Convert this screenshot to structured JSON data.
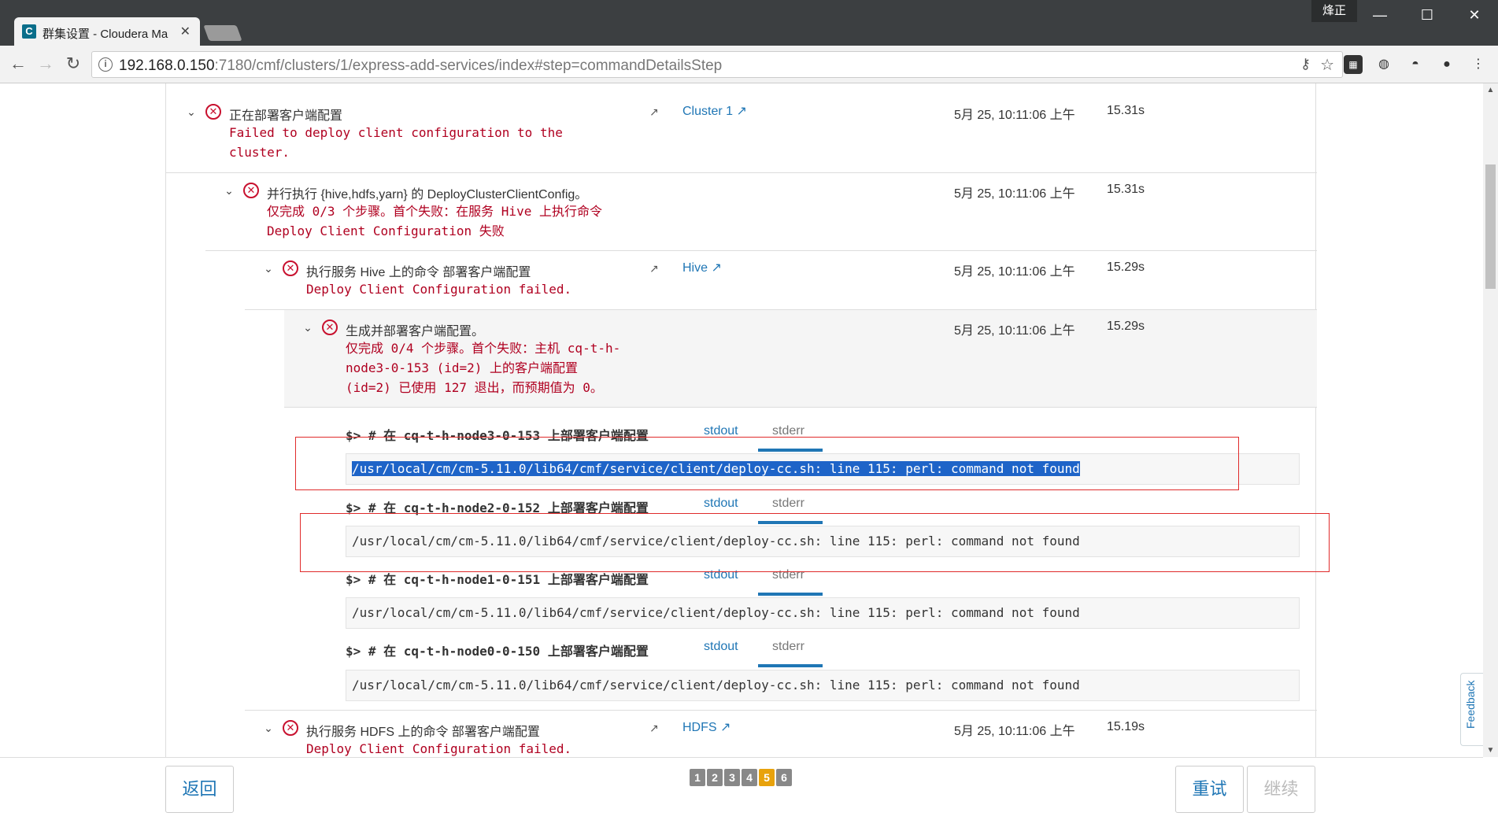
{
  "browser": {
    "tab_title": "群集设置 - Cloudera Ma",
    "tab_favicon": "C",
    "user_name": "烽正",
    "url_host": "192.168.0.150",
    "url_rest": ":7180/cmf/clusters/1/express-add-services/index#step=commandDetailsStep"
  },
  "commands": [
    {
      "title": "正在部署客户端配置",
      "message": "Failed to deploy client configuration to the\ncluster.",
      "target": "Cluster 1",
      "time": "5月 25, 10:11:06 上午",
      "duration": "15.31s"
    },
    {
      "title": "并行执行 {hive,hdfs,yarn} 的 DeployClusterClientConfig。",
      "message": "仅完成 0/3 个步骤。首个失败：在服务 Hive 上执行命令\nDeploy Client Configuration 失败",
      "time": "5月 25, 10:11:06 上午",
      "duration": "15.31s"
    },
    {
      "title": "执行服务 Hive 上的命令 部署客户端配置",
      "message": "Deploy Client Configuration failed.",
      "target": "Hive",
      "time": "5月 25, 10:11:06 上午",
      "duration": "15.29s"
    },
    {
      "title": "生成并部署客户端配置。",
      "message": "仅完成 0/4 个步骤。首个失败：主机 cq-t-h-\nnode3-0-153 (id=2) 上的客户端配置\n(id=2) 已使用 127 退出，而预期值为 0。",
      "time": "5月 25, 10:11:06 上午",
      "duration": "15.29s"
    },
    {
      "title": "执行服务 HDFS 上的命令 部署客户端配置",
      "message": "Deploy Client Configuration failed.",
      "target": "HDFS",
      "time": "5月 25, 10:11:06 上午",
      "duration": "15.19s"
    }
  ],
  "hosts": [
    {
      "header": "$> # 在 cq-t-h-node3-0-153 上部署客户端配置",
      "output": "/usr/local/cm/cm-5.11.0/lib64/cmf/service/client/deploy-cc.sh: line 115: perl: command not found"
    },
    {
      "header": "$> # 在 cq-t-h-node2-0-152 上部署客户端配置",
      "output": "/usr/local/cm/cm-5.11.0/lib64/cmf/service/client/deploy-cc.sh: line 115: perl: command not found"
    },
    {
      "header": "$> # 在 cq-t-h-node1-0-151 上部署客户端配置",
      "output": "/usr/local/cm/cm-5.11.0/lib64/cmf/service/client/deploy-cc.sh: line 115: perl: command not found"
    },
    {
      "header": "$> # 在 cq-t-h-node0-0-150 上部署客户端配置",
      "output": "/usr/local/cm/cm-5.11.0/lib64/cmf/service/client/deploy-cc.sh: line 115: perl: command not found"
    }
  ],
  "output_tabs": {
    "stdout": "stdout",
    "stderr": "stderr"
  },
  "feedback_label": "Feedback",
  "footer": {
    "back_label": "返回",
    "retry_label": "重试",
    "continue_label": "继续",
    "steps": [
      "1",
      "2",
      "3",
      "4",
      "5",
      "6"
    ],
    "active_step": "5"
  },
  "colors": {
    "error": "#c8102e",
    "link": "#1f76b5",
    "active_step": "#e8a20c"
  }
}
